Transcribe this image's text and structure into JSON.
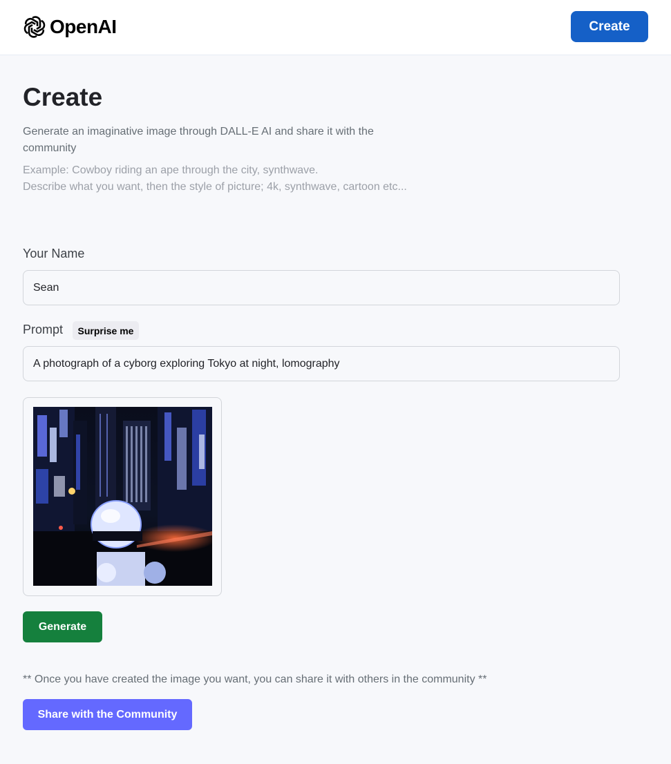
{
  "header": {
    "logo_text": "OpenAI",
    "create_label": "Create"
  },
  "page": {
    "title": "Create",
    "description": "Generate an imaginative image through DALL-E AI and share it with the community",
    "example_line1": "Example: Cowboy riding an ape through the city, synthwave.",
    "example_line2": "Describe what you want, then the style of picture; 4k, synthwave, cartoon etc..."
  },
  "form": {
    "name_label": "Your Name",
    "name_value": "Sean",
    "prompt_label": "Prompt",
    "surprise_label": "Surprise me",
    "prompt_value": "A photograph of a cyborg exploring Tokyo at night, lomography"
  },
  "actions": {
    "generate_label": "Generate",
    "share_note": "** Once you have created the image you want, you can share it with others in the community **",
    "share_label": "Share with the Community"
  },
  "colors": {
    "header_button": "#1560c7",
    "generate_button": "#15803d",
    "share_button": "#6469ff",
    "background": "#f7f8fb"
  },
  "icons": {
    "logo": "openai-logo-icon"
  }
}
